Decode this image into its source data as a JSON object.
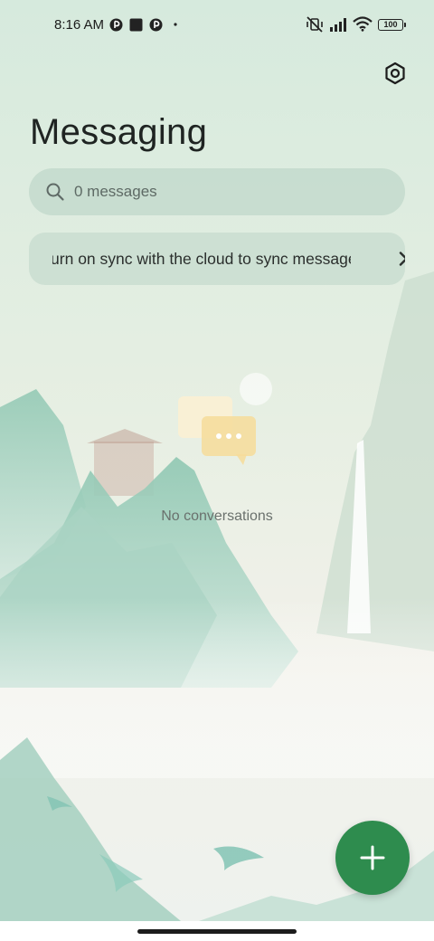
{
  "status_bar": {
    "time": "8:16 AM",
    "battery_level": "100",
    "icons": [
      "notification-app-icon",
      "stop-square-icon",
      "notification-app-icon",
      "dot-icon",
      "vibrate-off-icon",
      "signal-icon",
      "wifi-icon",
      "battery-icon"
    ]
  },
  "header": {
    "title": "Messaging",
    "settings_icon": "settings-icon"
  },
  "search": {
    "placeholder": "0 messages",
    "icon": "search-icon"
  },
  "sync_banner": {
    "text": "Turn on sync with the cloud to sync messages",
    "icon": "chevron-right-icon"
  },
  "empty_state": {
    "icon": "chat-bubbles-icon",
    "text": "No conversations"
  },
  "fab": {
    "icon": "plus-icon",
    "color": "#2e8c4e"
  },
  "colors": {
    "accent": "#2e8c4e",
    "background": "#e3efe6"
  }
}
